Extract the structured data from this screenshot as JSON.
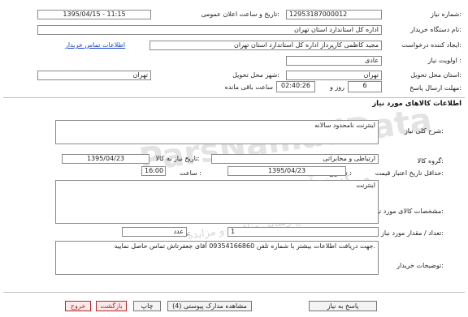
{
  "header": {
    "need_no_label": "شماره نیاز:",
    "need_no_value": "12953187000012",
    "announce_label": "تاریخ و ساعت اعلان عمومی:",
    "announce_value": "1395/04/15 - 11:15",
    "buyer_label": "نام دستگاه خریدار:",
    "buyer_value": "اداره کل استاندارد استان تهران",
    "creator_label": "ایجاد کننده درخواست:",
    "creator_value": "مجید کاظمی کارپرداز اداره کل استاندارد استان تهران",
    "contact_link": "اطلاعات تماس خریدار",
    "priority_label": "اولویت نیاز :",
    "priority_value": "عادی",
    "province_label": "استان محل تحویل:",
    "province_value": "تهران",
    "city_label": "شهر محل تحویل:",
    "city_value": "تهران",
    "deadline_label": "مهلت ارسال پاسخ:",
    "deadline_days": "6",
    "deadline_days_suffix": "روز و",
    "deadline_time": "02:40:26",
    "deadline_time_suffix": "ساعت باقی مانده"
  },
  "goods": {
    "section_title": "اطلاعات کالاهای مورد نیاز",
    "summary_label": "شرح کلی نیاز:",
    "summary_value": "اینترنت نامحدود سالانه",
    "group_label": "گروه کالا:",
    "group_value": "ارتباطی و مخابراتی",
    "need_date_label": "تاریخ نیاز به کالا:",
    "need_date_value": "1395/04/23",
    "min_price_label": "حداقل تاریخ اعتبار قیمت:",
    "until_date_label": "تا تاریخ :",
    "until_date_value": "1395/04/23",
    "time_label": "ساعت :",
    "time_value": "16:00",
    "spec_label": "مشخصات کالای مورد نیاز:",
    "spec_value": "اینترنت",
    "qty_label": "تعداد / مقدار مورد نیاز:",
    "qty_value": "1",
    "unit_label": "واحد شمارش:",
    "unit_value": "عدد",
    "notes_label": "توضیحات خریدار:",
    "notes_value": "جهت دریافت اطلاعات بیشتر با شماره تلفن 09354166860 آقای جعفرتاش تماس حاصل نمایید."
  },
  "watermark": {
    "line1": "ParsNamadData",
    "line2": "مرکز فرآوری اطلاعات پارس نماد داده",
    "line3": "پایگاه اطلاع رسانی مناقصه و مزایده"
  },
  "footer": {
    "reply_button": "پاسخ به نیاز",
    "attachments_button": "مشاهده مدارک پیوستی (4)",
    "print_button": "چاپ",
    "back_button": "بازگشت",
    "exit_button": "خروج"
  }
}
